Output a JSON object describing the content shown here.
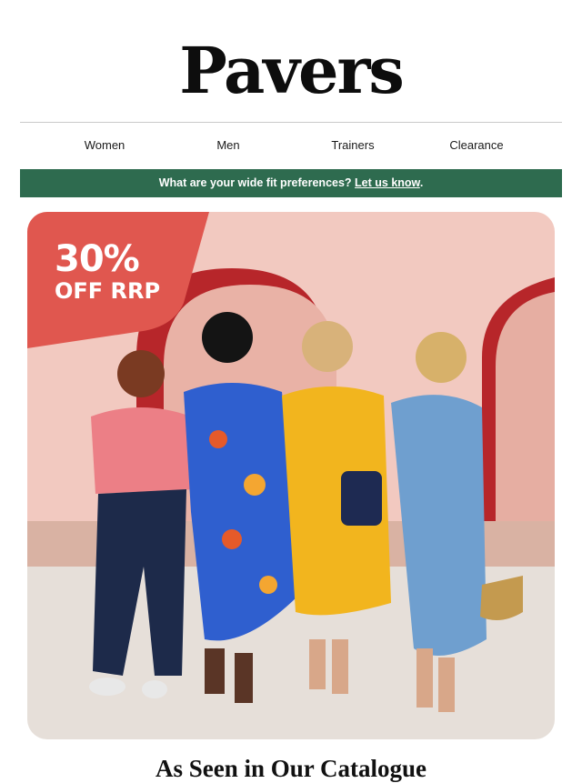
{
  "header": {
    "logo": "Pavers"
  },
  "nav": {
    "items": [
      "Women",
      "Men",
      "Trainers",
      "Clearance"
    ]
  },
  "banner": {
    "text": "What are your wide fit preferences?",
    "link": "Let us know",
    "suffix": ".",
    "color": "#2e6b4f"
  },
  "hero": {
    "badge_line1": "30%",
    "badge_line2": "OFF RRP",
    "badge_color": "#e0574f",
    "alt": "Four women walking arm in arm wearing summer outfits and sandals"
  },
  "section": {
    "title": "As Seen in Our Catalogue"
  }
}
